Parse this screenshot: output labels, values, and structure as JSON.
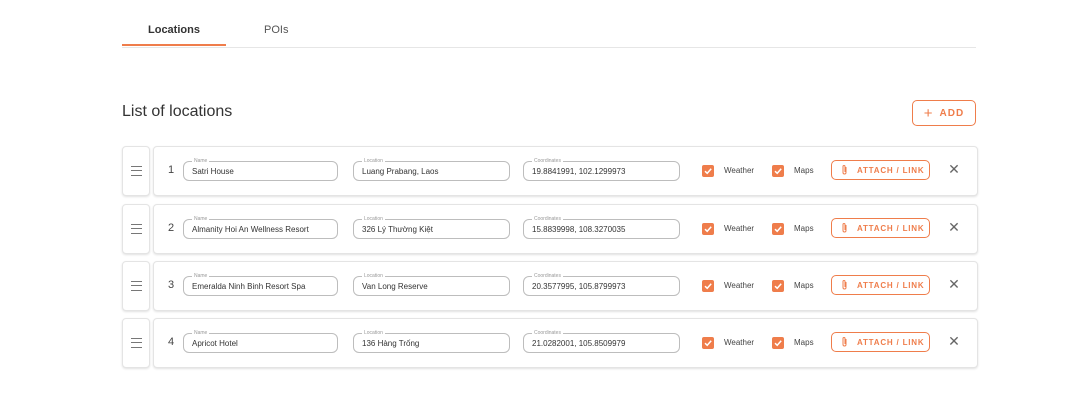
{
  "tabs": [
    {
      "label": "Locations"
    },
    {
      "label": "POIs"
    }
  ],
  "title": "List of locations",
  "add_label": "ADD",
  "labels": {
    "name": "Name",
    "location": "Location",
    "coordinates": "Coordinates",
    "weather": "Weather",
    "maps": "Maps",
    "attach": "ATTACH / LINK"
  },
  "accent": "#ef7d4b",
  "rows": [
    {
      "index": "1",
      "name": "Satri House",
      "location": "Luang Prabang, Laos",
      "coordinates": "19.8841991, 102.1299973"
    },
    {
      "index": "2",
      "name": "Almanity Hoi An Wellness Resort",
      "location": "326 Lý Thường Kiệt",
      "coordinates": "15.8839998, 108.3270035"
    },
    {
      "index": "3",
      "name": "Emeralda Ninh Binh Resort Spa",
      "location": "Van Long Reserve",
      "coordinates": "20.3577995, 105.8799973"
    },
    {
      "index": "4",
      "name": "Apricot Hotel",
      "location": "136 Hàng Trống",
      "coordinates": "21.0282001, 105.8509979"
    }
  ]
}
